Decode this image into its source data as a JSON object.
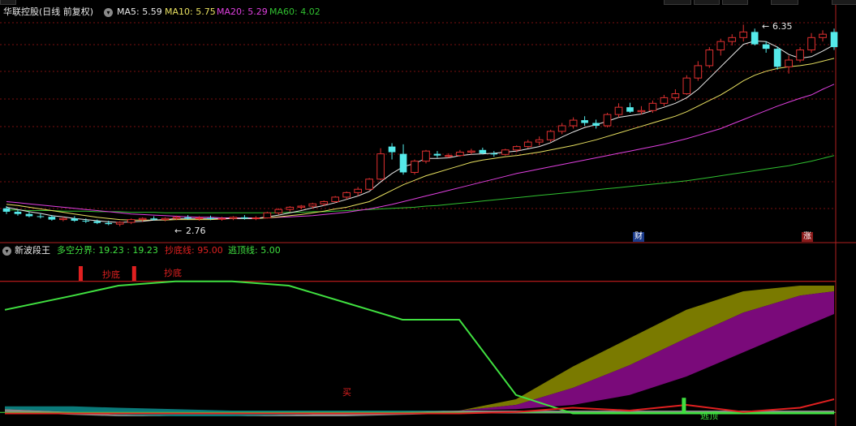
{
  "colors": {
    "grid": "#7a1010",
    "up": "#e03030",
    "down": "#55eaea",
    "ma5": "#e8e8e8",
    "ma10": "#e8e060",
    "ma20": "#e040e0",
    "ma60": "#30c030",
    "olive": "#7a7a00",
    "purple": "#7a0a7a",
    "teal": "#0a7a7a",
    "gray": "#8a8a8a",
    "green_line": "#40e040",
    "red_line": "#e02020"
  },
  "top_panel": {
    "title": "华联控股(日线 前复权)",
    "ma_labels": [
      {
        "key": "ma5",
        "text": "MA5: 5.59"
      },
      {
        "key": "ma10",
        "text": "MA10: 5.75"
      },
      {
        "key": "ma20",
        "text": "MA20: 5.29"
      },
      {
        "key": "ma60",
        "text": "MA60: 4.02"
      }
    ],
    "high_marker": "6.35",
    "low_marker": "2.76",
    "badges": [
      {
        "text": "财"
      },
      {
        "text": "涨"
      }
    ]
  },
  "bottom_panel": {
    "title": "新波段王",
    "label_split": "多空分界: 19.23 : 19.23",
    "label_buy": "抄底线: 95.00",
    "label_sell": "逃顶线: 5.00",
    "signals": {
      "buy": "抄底",
      "sell": "逃顶",
      "mai": "买"
    }
  },
  "footer_peek": "",
  "chart_data": [
    {
      "type": "candlestick",
      "title": "华联控股(日线 前复权)",
      "y_high": 6.35,
      "y_low": 2.76,
      "ohlc": [
        [
          3.08,
          3.12,
          2.98,
          3.02
        ],
        [
          3.02,
          3.06,
          2.95,
          2.98
        ],
        [
          2.98,
          3.02,
          2.92,
          2.94
        ],
        [
          2.94,
          2.99,
          2.9,
          2.93
        ],
        [
          2.93,
          2.96,
          2.86,
          2.88
        ],
        [
          2.88,
          2.93,
          2.85,
          2.9
        ],
        [
          2.9,
          2.94,
          2.84,
          2.86
        ],
        [
          2.86,
          2.9,
          2.82,
          2.85
        ],
        [
          2.85,
          2.88,
          2.8,
          2.82
        ],
        [
          2.82,
          2.86,
          2.78,
          2.8
        ],
        [
          2.8,
          2.85,
          2.76,
          2.83
        ],
        [
          2.83,
          2.9,
          2.8,
          2.88
        ],
        [
          2.88,
          2.92,
          2.84,
          2.9
        ],
        [
          2.9,
          2.94,
          2.86,
          2.88
        ],
        [
          2.88,
          2.92,
          2.85,
          2.9
        ],
        [
          2.9,
          2.95,
          2.87,
          2.92
        ],
        [
          2.92,
          2.96,
          2.88,
          2.9
        ],
        [
          2.9,
          2.94,
          2.86,
          2.91
        ],
        [
          2.91,
          2.95,
          2.87,
          2.89
        ],
        [
          2.89,
          2.93,
          2.86,
          2.9
        ],
        [
          2.9,
          2.94,
          2.87,
          2.92
        ],
        [
          2.92,
          2.96,
          2.88,
          2.9
        ],
        [
          2.9,
          2.94,
          2.87,
          2.91
        ],
        [
          2.91,
          3.02,
          2.9,
          3.0
        ],
        [
          3.0,
          3.08,
          2.97,
          3.06
        ],
        [
          3.06,
          3.12,
          3.02,
          3.1
        ],
        [
          3.1,
          3.14,
          3.06,
          3.12
        ],
        [
          3.12,
          3.18,
          3.08,
          3.16
        ],
        [
          3.16,
          3.22,
          3.12,
          3.2
        ],
        [
          3.2,
          3.3,
          3.18,
          3.28
        ],
        [
          3.28,
          3.38,
          3.24,
          3.36
        ],
        [
          3.36,
          3.46,
          3.3,
          3.42
        ],
        [
          3.42,
          3.62,
          3.4,
          3.6
        ],
        [
          3.6,
          4.15,
          3.58,
          4.05
        ],
        [
          4.18,
          4.24,
          3.95,
          4.08
        ],
        [
          4.05,
          4.22,
          3.68,
          3.72
        ],
        [
          3.72,
          3.95,
          3.68,
          3.92
        ],
        [
          3.92,
          4.12,
          3.88,
          4.1
        ],
        [
          4.05,
          4.1,
          3.98,
          4.02
        ],
        [
          4.02,
          4.06,
          3.98,
          4.02
        ],
        [
          4.02,
          4.12,
          4.0,
          4.08
        ],
        [
          4.08,
          4.14,
          4.04,
          4.1
        ],
        [
          4.12,
          4.16,
          4.04,
          4.06
        ],
        [
          4.06,
          4.1,
          4.0,
          4.04
        ],
        [
          4.04,
          4.14,
          4.02,
          4.12
        ],
        [
          4.12,
          4.2,
          4.08,
          4.18
        ],
        [
          4.18,
          4.3,
          4.15,
          4.26
        ],
        [
          4.26,
          4.36,
          4.2,
          4.3
        ],
        [
          4.3,
          4.48,
          4.26,
          4.45
        ],
        [
          4.45,
          4.6,
          4.4,
          4.55
        ],
        [
          4.55,
          4.7,
          4.5,
          4.65
        ],
        [
          4.65,
          4.72,
          4.55,
          4.6
        ],
        [
          4.6,
          4.66,
          4.5,
          4.55
        ],
        [
          4.55,
          4.78,
          4.52,
          4.75
        ],
        [
          4.75,
          4.95,
          4.7,
          4.88
        ],
        [
          4.88,
          4.96,
          4.78,
          4.8
        ],
        [
          4.8,
          4.9,
          4.75,
          4.82
        ],
        [
          4.82,
          5.0,
          4.78,
          4.95
        ],
        [
          4.95,
          5.1,
          4.9,
          5.05
        ],
        [
          5.05,
          5.2,
          5.0,
          5.12
        ],
        [
          5.12,
          5.45,
          5.1,
          5.4
        ],
        [
          5.4,
          5.7,
          5.35,
          5.62
        ],
        [
          5.62,
          5.95,
          5.58,
          5.9
        ],
        [
          5.9,
          6.1,
          5.8,
          6.05
        ],
        [
          6.05,
          6.18,
          5.98,
          6.12
        ],
        [
          6.12,
          6.35,
          6.05,
          6.22
        ],
        [
          6.22,
          6.28,
          5.98,
          6.0
        ],
        [
          6.0,
          6.05,
          5.85,
          5.92
        ],
        [
          5.92,
          5.96,
          5.55,
          5.6
        ],
        [
          5.6,
          5.8,
          5.48,
          5.72
        ],
        [
          5.72,
          5.95,
          5.68,
          5.9
        ],
        [
          5.9,
          6.2,
          5.85,
          6.12
        ],
        [
          6.12,
          6.25,
          6.05,
          6.18
        ],
        [
          6.22,
          6.28,
          5.9,
          5.95
        ]
      ],
      "ma5": [
        3.1,
        3.06,
        3.02,
        2.99,
        2.95,
        2.93,
        2.9,
        2.88,
        2.86,
        2.84,
        2.83,
        2.84,
        2.85,
        2.87,
        2.88,
        2.9,
        2.9,
        2.9,
        2.9,
        2.9,
        2.9,
        2.9,
        2.9,
        2.93,
        2.96,
        3.0,
        3.04,
        3.09,
        3.13,
        3.18,
        3.24,
        3.3,
        3.38,
        3.55,
        3.7,
        3.82,
        3.88,
        3.97,
        3.97,
        3.98,
        4.02,
        4.04,
        4.05,
        4.06,
        4.08,
        4.1,
        4.14,
        4.18,
        4.25,
        4.35,
        4.44,
        4.52,
        4.57,
        4.63,
        4.7,
        4.73,
        4.76,
        4.82,
        4.88,
        4.95,
        5.05,
        5.2,
        5.4,
        5.6,
        5.8,
        6.0,
        6.06,
        6.05,
        5.95,
        5.82,
        5.75,
        5.78,
        5.88,
        5.99
      ],
      "ma10": [
        3.15,
        3.13,
        3.1,
        3.07,
        3.04,
        3.01,
        2.98,
        2.95,
        2.92,
        2.9,
        2.88,
        2.87,
        2.87,
        2.87,
        2.87,
        2.88,
        2.88,
        2.88,
        2.88,
        2.89,
        2.9,
        2.9,
        2.9,
        2.91,
        2.93,
        2.95,
        2.97,
        3.0,
        3.03,
        3.07,
        3.1,
        3.15,
        3.2,
        3.3,
        3.4,
        3.5,
        3.58,
        3.66,
        3.72,
        3.78,
        3.84,
        3.9,
        3.94,
        3.97,
        4.0,
        4.02,
        4.05,
        4.08,
        4.12,
        4.16,
        4.2,
        4.25,
        4.3,
        4.36,
        4.42,
        4.48,
        4.54,
        4.6,
        4.66,
        4.72,
        4.8,
        4.9,
        5.0,
        5.1,
        5.22,
        5.35,
        5.45,
        5.52,
        5.57,
        5.6,
        5.62,
        5.65,
        5.7,
        5.75
      ],
      "ma20": [
        3.2,
        3.18,
        3.16,
        3.14,
        3.12,
        3.1,
        3.08,
        3.06,
        3.04,
        3.02,
        3.0,
        2.98,
        2.97,
        2.96,
        2.95,
        2.94,
        2.93,
        2.92,
        2.92,
        2.91,
        2.91,
        2.91,
        2.91,
        2.91,
        2.92,
        2.93,
        2.94,
        2.95,
        2.97,
        2.99,
        3.01,
        3.04,
        3.07,
        3.11,
        3.15,
        3.2,
        3.25,
        3.3,
        3.35,
        3.4,
        3.45,
        3.5,
        3.55,
        3.6,
        3.65,
        3.7,
        3.74,
        3.78,
        3.82,
        3.86,
        3.9,
        3.94,
        3.98,
        4.02,
        4.06,
        4.1,
        4.14,
        4.18,
        4.22,
        4.27,
        4.32,
        4.38,
        4.44,
        4.5,
        4.58,
        4.66,
        4.74,
        4.82,
        4.9,
        4.97,
        5.04,
        5.1,
        5.2,
        5.29
      ],
      "ma60": [
        3.05,
        3.05,
        3.04,
        3.04,
        3.04,
        3.03,
        3.03,
        3.03,
        3.02,
        3.02,
        3.02,
        3.01,
        3.01,
        3.01,
        3.0,
        3.0,
        3.0,
        3.0,
        3.0,
        3.0,
        3.0,
        3.0,
        3.0,
        3.0,
        3.0,
        3.01,
        3.01,
        3.02,
        3.02,
        3.03,
        3.04,
        3.05,
        3.06,
        3.07,
        3.08,
        3.09,
        3.1,
        3.12,
        3.13,
        3.15,
        3.17,
        3.19,
        3.21,
        3.23,
        3.25,
        3.27,
        3.29,
        3.31,
        3.33,
        3.35,
        3.37,
        3.39,
        3.41,
        3.43,
        3.45,
        3.47,
        3.49,
        3.51,
        3.53,
        3.55,
        3.57,
        3.6,
        3.63,
        3.66,
        3.69,
        3.72,
        3.75,
        3.78,
        3.81,
        3.84,
        3.88,
        3.92,
        3.97,
        4.02
      ]
    },
    {
      "type": "area",
      "title": "新波段王",
      "ylim": [
        0,
        100
      ],
      "reference_lines": [
        95,
        5
      ],
      "x": [
        0,
        6,
        10,
        15,
        20,
        25,
        30,
        35,
        40,
        45,
        50,
        55,
        60,
        65,
        70,
        73
      ],
      "green_line": [
        75,
        85,
        92,
        95,
        95,
        92,
        80,
        68,
        68,
        15,
        2,
        2,
        2,
        2,
        2,
        2
      ],
      "olive_top": [
        4,
        4,
        4,
        4,
        4,
        4,
        4,
        4,
        4,
        12,
        35,
        55,
        75,
        88,
        92,
        92
      ],
      "purple_top": [
        4,
        4,
        4,
        4,
        4,
        4,
        4,
        4,
        4,
        8,
        20,
        36,
        55,
        73,
        85,
        88
      ],
      "purple_bottom": [
        4,
        4,
        4,
        4,
        4,
        4,
        4,
        4,
        4,
        5,
        8,
        15,
        28,
        45,
        62,
        72
      ],
      "teal_top": [
        7,
        7,
        6,
        5,
        4,
        4,
        4,
        4,
        4,
        4,
        4,
        4,
        4,
        4,
        4,
        4
      ],
      "teal_bottom": [
        5,
        3,
        1,
        0,
        0,
        1,
        2,
        3,
        4,
        4,
        4,
        4,
        4,
        4,
        4,
        4
      ],
      "red_line": [
        2,
        2,
        2,
        2,
        2,
        2,
        2,
        2,
        2,
        3,
        6,
        4,
        8,
        3,
        6,
        12
      ]
    }
  ]
}
